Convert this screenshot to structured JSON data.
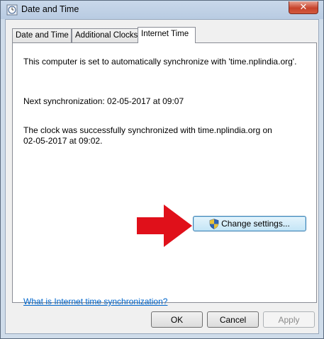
{
  "window": {
    "title": "Date and Time",
    "close_label": "✕"
  },
  "tabs": [
    {
      "label": "Date and Time",
      "active": false
    },
    {
      "label": "Additional Clocks",
      "active": false
    },
    {
      "label": "Internet Time",
      "active": true
    }
  ],
  "internet_time": {
    "sync_info": "This computer is set to automatically synchronize with 'time.nplindia.org'.",
    "next_sync": "Next synchronization: 02-05-2017 at 09:07",
    "status_line1": "The clock was successfully synchronized with time.nplindia.org on",
    "status_line2": "02-05-2017 at 09:02.",
    "change_settings_label": "Change settings...",
    "help_link": "What is Internet time synchronization?"
  },
  "buttons": {
    "ok": "OK",
    "cancel": "Cancel",
    "apply": "Apply"
  },
  "colors": {
    "arrow": "#e0101a",
    "link": "#0066cc"
  },
  "icons": {
    "window_icon": "clock-icon",
    "uac_shield": "shield-icon",
    "annotation": "red-arrow-icon"
  }
}
